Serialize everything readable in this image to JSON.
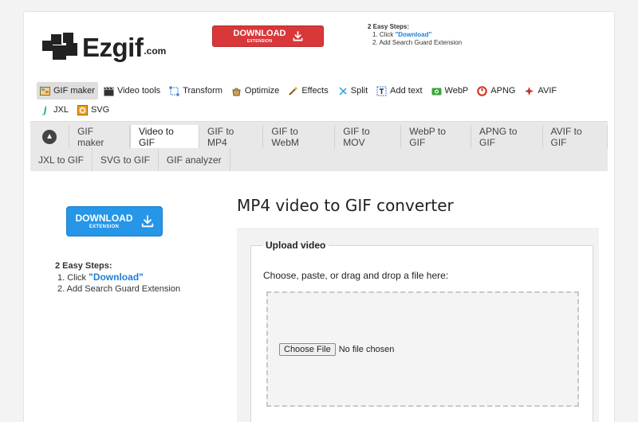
{
  "header": {
    "logo_text": "Ezgif",
    "logo_suffix": ".com",
    "download_button": {
      "main": "DOWNLOAD",
      "sub": "EXTENSION"
    },
    "steps": {
      "title": "2 Easy Steps:",
      "step1_prefix": "1. Click ",
      "step1_link": "\"Download\"",
      "step2": "2. Add Search Guard Extension"
    }
  },
  "tools_menu": [
    {
      "label": "GIF maker",
      "icon": "gif-maker-icon",
      "active": true
    },
    {
      "label": "Video tools",
      "icon": "clapperboard-icon"
    },
    {
      "label": "Transform",
      "icon": "transform-icon"
    },
    {
      "label": "Optimize",
      "icon": "optimize-icon"
    },
    {
      "label": "Effects",
      "icon": "magic-wand-icon"
    },
    {
      "label": "Split",
      "icon": "scissors-icon"
    },
    {
      "label": "Add text",
      "icon": "add-text-icon"
    },
    {
      "label": "WebP",
      "icon": "webp-icon"
    },
    {
      "label": "APNG",
      "icon": "apng-icon"
    },
    {
      "label": "AVIF",
      "icon": "avif-icon"
    },
    {
      "label": "JXL",
      "icon": "jxl-icon"
    },
    {
      "label": "SVG",
      "icon": "svg-icon"
    }
  ],
  "subtabs": {
    "row1": [
      "GIF maker",
      "Video to GIF",
      "GIF to MP4",
      "GIF to WebM",
      "GIF to MOV",
      "WebP to GIF",
      "APNG to GIF",
      "AVIF to GIF"
    ],
    "row2": [
      "JXL to GIF",
      "SVG to GIF",
      "GIF analyzer"
    ],
    "selected": "Video to GIF"
  },
  "sidebar": {
    "download_button": {
      "main": "DOWNLOAD",
      "sub": "EXTENSION"
    },
    "steps": {
      "title": "2 Easy Steps:",
      "step1_prefix": "1. Click ",
      "step1_link": "\"Download\"",
      "step2": "2. Add Search Guard Extension"
    }
  },
  "main": {
    "title": "MP4 video to GIF converter",
    "upload": {
      "legend": "Upload video",
      "instructions": "Choose, paste, or drag and drop a file here:",
      "choose_button": "Choose File",
      "file_status": "No file chosen"
    }
  },
  "colors": {
    "download_red": "#d9383a",
    "download_blue": "#2596e8",
    "link_blue": "#1d7fd6"
  }
}
